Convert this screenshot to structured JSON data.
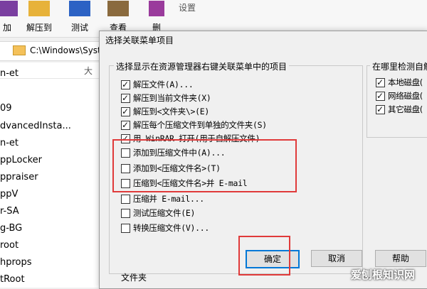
{
  "toolbar": {
    "buttons": [
      {
        "label": "加"
      },
      {
        "label": "解压到"
      },
      {
        "label": "测试"
      },
      {
        "label": "查看"
      },
      {
        "label": "删"
      }
    ],
    "settings_label": "设置"
  },
  "address_bar": {
    "path": "C:\\Windows\\Syste"
  },
  "file_list": {
    "header": "大",
    "rows": [
      "n-et",
      "09",
      "dvancedInsta...",
      "n-et",
      "ppLocker",
      "ppraiser",
      "ppV",
      "r-SA",
      "g-BG",
      "root",
      "hprops",
      "tRoot"
    ],
    "type_column_value": "文件夹"
  },
  "dialog": {
    "title": "选择关联菜单项目",
    "main_group_label": "选择显示在资源管理器右键关联菜单中的项目",
    "options": [
      {
        "label": "解压文件(A)...",
        "checked": true
      },
      {
        "label": "解压到当前文件夹(X)",
        "checked": true
      },
      {
        "label": "解压到<文件夹\\>(E)",
        "checked": true
      },
      {
        "label": "解压每个压缩文件到单独的文件夹(S)",
        "checked": true
      },
      {
        "label": "用 WinRAR 打开(用于自解压文件)",
        "checked": true
      },
      {
        "label": "添加到压缩文件中(A)...",
        "checked": false
      },
      {
        "label": "添加到<压缩文件名>(T)",
        "checked": false
      },
      {
        "label": "压缩到<压缩文件名>并 E-mail",
        "checked": false
      },
      {
        "label": "压缩并 E-mail...",
        "checked": false
      },
      {
        "label": "测试压缩文件(E)",
        "checked": false
      },
      {
        "label": "转换压缩文件(V)...",
        "checked": false
      }
    ],
    "side_group_label": "在哪里检测自解",
    "side_options": [
      {
        "label": "本地磁盘(",
        "checked": true
      },
      {
        "label": "网络磁盘(",
        "checked": true
      },
      {
        "label": "其它磁盘(",
        "checked": true
      }
    ],
    "buttons": {
      "ok": "确定",
      "cancel": "取消",
      "help": "帮助"
    }
  },
  "watermark": "爱刨根知识网",
  "colors": {
    "highlight_red": "#e03a3a",
    "focus_blue": "#0078d7"
  }
}
